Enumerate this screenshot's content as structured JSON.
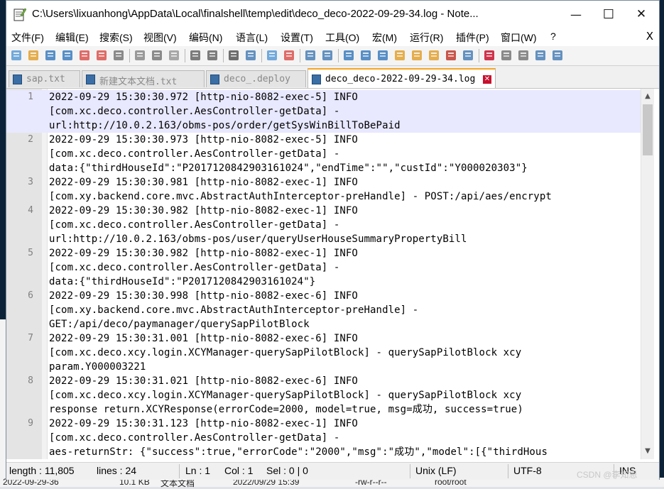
{
  "window": {
    "title": "C:\\Users\\lixuanhong\\AppData\\Local\\finalshell\\temp\\edit\\deco_deco-2022-09-29-34.log - Note...",
    "minimize": "—",
    "maximize": "☐",
    "close": "✕"
  },
  "menu": {
    "items": [
      "文件(F)",
      "编辑(E)",
      "搜索(S)",
      "视图(V)",
      "编码(N)",
      "语言(L)",
      "设置(T)",
      "工具(O)",
      "宏(M)",
      "运行(R)",
      "插件(P)",
      "窗口(W)",
      "?"
    ],
    "close": "X"
  },
  "toolbar": {
    "icons": [
      "new-file-icon",
      "open-file-icon",
      "save-icon",
      "save-all-icon",
      "close-file-icon",
      "close-all-icon",
      "print-icon",
      "cut-icon",
      "copy-icon",
      "paste-icon",
      "undo-icon",
      "redo-icon",
      "find-icon",
      "replace-icon",
      "zoom-in-icon",
      "zoom-out-icon",
      "sync-vertical-icon",
      "sync-horizontal-icon",
      "word-wrap-icon",
      "show-all-chars-icon",
      "indent-guide-icon",
      "doc-map-icon",
      "function-list-icon",
      "folder-workspace-icon",
      "doc-list-icon",
      "monitoring-icon",
      "record-macro-icon",
      "stop-record-icon",
      "play-macro-icon",
      "run-macro-multiple-icon",
      "save-macro-icon"
    ]
  },
  "tabs": [
    {
      "label": "sap.txt",
      "active": false
    },
    {
      "label": "新建文本文档.txt",
      "active": false
    },
    {
      "label": "deco_.deploy",
      "active": false
    },
    {
      "label": "deco_deco-2022-09-29-34.log",
      "active": true
    }
  ],
  "editor": {
    "lines": [
      {
        "num": "1",
        "text": "2022-09-29 15:30:30.972 [http-nio-8082-exec-5] INFO",
        "hl": true
      },
      {
        "num": "",
        "text": "[com.xc.deco.controller.AesController-getData] -",
        "hl": true
      },
      {
        "num": "",
        "text": "url:http://10.0.2.163/obms-pos/order/getSysWinBillToBePaid",
        "hl": true
      },
      {
        "num": "2",
        "text": "2022-09-29 15:30:30.973 [http-nio-8082-exec-5] INFO",
        "hl": false
      },
      {
        "num": "",
        "text": "[com.xc.deco.controller.AesController-getData] -",
        "hl": false
      },
      {
        "num": "",
        "text": "data:{\"thirdHouseId\":\"P2017120842903161024\",\"endTime\":\"\",\"custId\":\"Y000020303\"}",
        "hl": false
      },
      {
        "num": "3",
        "text": "2022-09-29 15:30:30.981 [http-nio-8082-exec-1] INFO",
        "hl": false
      },
      {
        "num": "",
        "text": "[com.xy.backend.core.mvc.AbstractAuthInterceptor-preHandle] - POST:/api/aes/encrypt",
        "hl": false
      },
      {
        "num": "4",
        "text": "2022-09-29 15:30:30.982 [http-nio-8082-exec-1] INFO",
        "hl": false
      },
      {
        "num": "",
        "text": "[com.xc.deco.controller.AesController-getData] -",
        "hl": false
      },
      {
        "num": "",
        "text": "url:http://10.0.2.163/obms-pos/user/queryUserHouseSummaryPropertyBill",
        "hl": false
      },
      {
        "num": "5",
        "text": "2022-09-29 15:30:30.982 [http-nio-8082-exec-1] INFO",
        "hl": false
      },
      {
        "num": "",
        "text": "[com.xc.deco.controller.AesController-getData] -",
        "hl": false
      },
      {
        "num": "",
        "text": "data:{\"thirdHouseId\":\"P2017120842903161024\"}",
        "hl": false
      },
      {
        "num": "6",
        "text": "2022-09-29 15:30:30.998 [http-nio-8082-exec-6] INFO",
        "hl": false
      },
      {
        "num": "",
        "text": "[com.xy.backend.core.mvc.AbstractAuthInterceptor-preHandle] -",
        "hl": false
      },
      {
        "num": "",
        "text": "GET:/api/deco/paymanager/querySapPilotBlock",
        "hl": false
      },
      {
        "num": "7",
        "text": "2022-09-29 15:30:31.001 [http-nio-8082-exec-6] INFO",
        "hl": false
      },
      {
        "num": "",
        "text": "[com.xc.deco.xcy.login.XCYManager-querySapPilotBlock] - querySapPilotBlock xcy",
        "hl": false
      },
      {
        "num": "",
        "text": "param.Y000003221",
        "hl": false
      },
      {
        "num": "8",
        "text": "2022-09-29 15:30:31.021 [http-nio-8082-exec-6] INFO",
        "hl": false
      },
      {
        "num": "",
        "text": "[com.xc.deco.xcy.login.XCYManager-querySapPilotBlock] - querySapPilotBlock xcy",
        "hl": false
      },
      {
        "num": "",
        "text": "response return.XCYResponse(errorCode=2000, model=true, msg=成功, success=true)",
        "hl": false
      },
      {
        "num": "9",
        "text": "2022-09-29 15:30:31.123 [http-nio-8082-exec-1] INFO",
        "hl": false
      },
      {
        "num": "",
        "text": "[com.xc.deco.controller.AesController-getData] -",
        "hl": false
      },
      {
        "num": "",
        "text": "aes-returnStr: {\"success\":true,\"errorCode\":\"2000\",\"msg\":\"成功\",\"model\":[{\"thirdHous",
        "hl": false
      }
    ]
  },
  "status": {
    "length": "length : 11,805",
    "lines": "lines : 24",
    "ln": "Ln : 1",
    "col": "Col : 1",
    "sel": "Sel : 0 | 0",
    "eol": "Unix (LF)",
    "encoding": "UTF-8",
    "mode": "INS"
  },
  "watermark": "CSDN @李知恩",
  "background": {
    "bottom_text": [
      "2022-09-29-36",
      "10.1 KB",
      "文本文档",
      "2022/09/29 15:39",
      "-rw-r--r--",
      "root/root"
    ]
  },
  "colors": {
    "accent_tab": "#f5a623",
    "tab_close": "#c8102e",
    "current_line": "#e8e8ff",
    "gutter": "#e4e4e4"
  }
}
